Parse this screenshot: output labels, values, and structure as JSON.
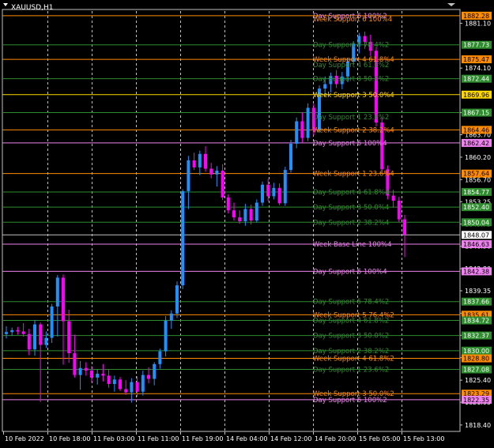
{
  "window": {
    "title": "XAUUSD,H1",
    "menu_icon": "triangle-down-icon",
    "scroll_icon": "triangle-down-icon"
  },
  "colors": {
    "background": "#000000",
    "bull": "#1e90ff",
    "bear": "#ff00ff",
    "text": "#ffffff",
    "week_line": "#ff8c00",
    "week_yellow": "#ffd700",
    "day_resist": "#2e8b2e",
    "day_support": "#ee82ee",
    "grid": "#c0c0c0"
  },
  "chart_data": {
    "type": "candlestick",
    "symbol": "XAUUSD",
    "timeframe": "H1",
    "y_axis_ticks": [
      "1881.10",
      "1874.10",
      "1867.15",
      "1863.70",
      "1860.20",
      "1856.70",
      "1853.25",
      "1849.75",
      "1846.30",
      "1842.80",
      "1839.35",
      "1835.85",
      "1832.40",
      "1828.90",
      "1825.40",
      "1821.95",
      "1818.40"
    ],
    "x_axis_ticks": [
      "10 Feb 2022",
      "10 Feb 18:00",
      "11 Feb 03:00",
      "11 Feb 11:00",
      "11 Feb 19:00",
      "14 Feb 04:00",
      "14 Feb 12:00",
      "14 Feb 20:00",
      "15 Feb 05:00",
      "15 Feb 13:00"
    ],
    "price_tags": [
      {
        "value": "1882.28",
        "type": "week"
      },
      {
        "value": "1877.73",
        "type": "day"
      },
      {
        "value": "1875.47",
        "type": "week"
      },
      {
        "value": "1872.44",
        "type": "day"
      },
      {
        "value": "1869.96",
        "type": "week-yellow"
      },
      {
        "value": "1867.15",
        "type": "day"
      },
      {
        "value": "1864.46",
        "type": "week"
      },
      {
        "value": "1862.42",
        "type": "daysupp"
      },
      {
        "value": "1857.64",
        "type": "week"
      },
      {
        "value": "1854.77",
        "type": "day"
      },
      {
        "value": "1852.40",
        "type": "day"
      },
      {
        "value": "1850.04",
        "type": "day"
      },
      {
        "value": "1848.07",
        "type": "current"
      },
      {
        "value": "1846.63",
        "type": "daysupp"
      },
      {
        "value": "1842.38",
        "type": "daysupp"
      },
      {
        "value": "1837.66",
        "type": "day"
      },
      {
        "value": "1835.61",
        "type": "week"
      },
      {
        "value": "1834.72",
        "type": "day"
      },
      {
        "value": "1832.37",
        "type": "day"
      },
      {
        "value": "1830.00",
        "type": "day"
      },
      {
        "value": "1828.80",
        "type": "week"
      },
      {
        "value": "1827.08",
        "type": "day"
      },
      {
        "value": "1823.29",
        "type": "week"
      },
      {
        "value": "1822.35",
        "type": "daysupp"
      }
    ],
    "level_labels": [
      {
        "text": "Day Support 6 100%2",
        "kind": "daysupp",
        "price": 1882.28
      },
      {
        "text": "Week Support 6 100%4",
        "kind": "week",
        "price": 1881.75
      },
      {
        "text": "Day Support 5 78.4%2",
        "kind": "day",
        "price": 1877.73
      },
      {
        "text": "Week Support 4 61.8%4",
        "kind": "week",
        "price": 1875.47
      },
      {
        "text": "Day Support 4 61.8%2",
        "kind": "day",
        "price": 1874.6
      },
      {
        "text": "Day Support 3 50.0%2",
        "kind": "day",
        "price": 1872.44
      },
      {
        "text": "Week Support 3 50.0%4",
        "kind": "week-yellow",
        "price": 1869.96
      },
      {
        "text": "Day Support 1 23.6%2",
        "kind": "day",
        "price": 1866.5
      },
      {
        "text": "Week Support 2 38.2%4",
        "kind": "week",
        "price": 1864.46
      },
      {
        "text": "Day Support 6 100%4",
        "kind": "daysupp",
        "price": 1862.42
      },
      {
        "text": "Week Support 1 23.6%4",
        "kind": "week",
        "price": 1857.64
      },
      {
        "text": "Day Support 4 61.8%4",
        "kind": "day",
        "price": 1854.77
      },
      {
        "text": "Day Support 3 50.0%4",
        "kind": "day",
        "price": 1852.4
      },
      {
        "text": "Day Support 2 38.2%4",
        "kind": "day",
        "price": 1850.04
      },
      {
        "text": "Week Base Line 100%4",
        "kind": "daysupp",
        "price": 1846.63
      },
      {
        "text": "Day Support 6 100%4",
        "kind": "daysupp",
        "price": 1842.38
      },
      {
        "text": "Day Support 5 78.4%2",
        "kind": "day",
        "price": 1837.66
      },
      {
        "text": "Week Support 5 76.4%2",
        "kind": "week",
        "price": 1835.61
      },
      {
        "text": "Day Support 4 61.8%2",
        "kind": "day",
        "price": 1834.72
      },
      {
        "text": "Day Support 3 50.0%2",
        "kind": "day",
        "price": 1832.37
      },
      {
        "text": "Day Support 2 38.2%2",
        "kind": "day",
        "price": 1830.0
      },
      {
        "text": "Week Support 4 61.8%2",
        "kind": "week",
        "price": 1828.8
      },
      {
        "text": "Day Support 1 23.6%2",
        "kind": "day",
        "price": 1827.08
      },
      {
        "text": "Week Support 3 50.0%2",
        "kind": "week",
        "price": 1823.29
      },
      {
        "text": "Day Support 6 100%2",
        "kind": "daysupp",
        "price": 1822.35
      }
    ],
    "candles": [
      [
        1832.6,
        1833.8,
        1831.9,
        1832.9
      ],
      [
        1832.9,
        1833.6,
        1832.3,
        1833.2
      ],
      [
        1833.2,
        1833.7,
        1832.5,
        1833.0
      ],
      [
        1833.0,
        1834.3,
        1832.2,
        1832.6
      ],
      [
        1832.6,
        1833.4,
        1829.3,
        1830.2
      ],
      [
        1830.2,
        1834.8,
        1829.2,
        1834.1
      ],
      [
        1834.1,
        1834.4,
        1822.0,
        1830.9
      ],
      [
        1830.9,
        1833.0,
        1830.4,
        1832.0
      ],
      [
        1832.0,
        1837.3,
        1831.2,
        1836.9
      ],
      [
        1836.9,
        1841.8,
        1832.2,
        1841.4
      ],
      [
        1841.4,
        1841.9,
        1827.8,
        1834.6
      ],
      [
        1834.6,
        1836.4,
        1828.1,
        1829.6
      ],
      [
        1829.6,
        1832.5,
        1825.8,
        1826.2
      ],
      [
        1826.2,
        1828.4,
        1823.9,
        1827.3
      ],
      [
        1827.3,
        1828.2,
        1826.1,
        1826.9
      ],
      [
        1826.9,
        1827.6,
        1825.0,
        1825.8
      ],
      [
        1825.8,
        1827.1,
        1824.7,
        1826.4
      ],
      [
        1826.4,
        1827.9,
        1825.2,
        1826.1
      ],
      [
        1826.1,
        1827.0,
        1824.2,
        1824.8
      ],
      [
        1824.8,
        1826.1,
        1823.6,
        1825.5
      ],
      [
        1825.5,
        1825.9,
        1823.7,
        1824.0
      ],
      [
        1824.0,
        1825.4,
        1823.1,
        1823.5
      ],
      [
        1823.5,
        1825.7,
        1821.9,
        1825.1
      ],
      [
        1825.1,
        1826.0,
        1822.8,
        1823.6
      ],
      [
        1823.6,
        1826.9,
        1823.0,
        1826.2
      ],
      [
        1826.2,
        1827.4,
        1824.9,
        1825.6
      ],
      [
        1825.6,
        1828.2,
        1824.6,
        1827.9
      ],
      [
        1827.9,
        1830.3,
        1827.2,
        1829.9
      ],
      [
        1829.9,
        1835.4,
        1829.1,
        1834.7
      ],
      [
        1834.7,
        1836.3,
        1833.4,
        1835.8
      ],
      [
        1835.8,
        1840.8,
        1835.1,
        1840.2
      ],
      [
        1840.2,
        1855.2,
        1839.6,
        1854.9
      ],
      [
        1854.9,
        1860.4,
        1852.1,
        1859.7
      ],
      [
        1859.7,
        1860.9,
        1858.2,
        1858.6
      ],
      [
        1858.6,
        1861.2,
        1857.4,
        1860.7
      ],
      [
        1860.7,
        1861.9,
        1857.9,
        1858.4
      ],
      [
        1858.4,
        1859.3,
        1856.9,
        1857.5
      ],
      [
        1857.5,
        1858.8,
        1855.6,
        1858.1
      ],
      [
        1858.1,
        1859.1,
        1853.5,
        1853.9
      ],
      [
        1853.9,
        1854.4,
        1851.4,
        1851.9
      ],
      [
        1851.9,
        1853.1,
        1850.3,
        1850.8
      ],
      [
        1850.8,
        1851.9,
        1849.8,
        1850.2
      ],
      [
        1850.2,
        1852.9,
        1849.5,
        1852.1
      ],
      [
        1852.1,
        1852.8,
        1849.7,
        1850.3
      ],
      [
        1850.3,
        1853.6,
        1850.0,
        1853.1
      ],
      [
        1853.1,
        1856.4,
        1852.6,
        1855.9
      ],
      [
        1855.9,
        1856.8,
        1853.3,
        1854.1
      ],
      [
        1854.1,
        1856.2,
        1853.6,
        1855.4
      ],
      [
        1855.4,
        1856.1,
        1852.7,
        1853.0
      ],
      [
        1853.0,
        1858.7,
        1852.6,
        1858.2
      ],
      [
        1858.2,
        1862.9,
        1857.8,
        1862.3
      ],
      [
        1862.3,
        1866.4,
        1861.6,
        1865.8
      ],
      [
        1865.8,
        1867.2,
        1862.5,
        1863.2
      ],
      [
        1863.2,
        1868.6,
        1862.7,
        1867.9
      ],
      [
        1867.9,
        1868.5,
        1863.6,
        1864.4
      ],
      [
        1864.4,
        1871.4,
        1864.0,
        1870.9
      ],
      [
        1870.9,
        1872.8,
        1869.6,
        1871.6
      ],
      [
        1871.6,
        1873.4,
        1870.3,
        1872.9
      ],
      [
        1872.9,
        1873.8,
        1871.0,
        1871.6
      ],
      [
        1871.6,
        1873.5,
        1870.8,
        1872.8
      ],
      [
        1872.8,
        1875.6,
        1871.9,
        1875.1
      ],
      [
        1875.1,
        1878.3,
        1874.6,
        1877.9
      ],
      [
        1877.9,
        1879.6,
        1876.4,
        1879.1
      ],
      [
        1879.1,
        1879.8,
        1877.1,
        1878.2
      ],
      [
        1878.2,
        1879.3,
        1876.0,
        1876.8
      ],
      [
        1876.8,
        1877.4,
        1865.0,
        1865.6
      ],
      [
        1865.6,
        1866.4,
        1857.9,
        1858.3
      ],
      [
        1858.3,
        1858.9,
        1853.6,
        1854.2
      ],
      [
        1854.2,
        1855.1,
        1852.3,
        1853.4
      ],
      [
        1853.4,
        1854.0,
        1850.1,
        1850.5
      ],
      [
        1850.5,
        1851.2,
        1844.6,
        1848.1
      ]
    ]
  }
}
